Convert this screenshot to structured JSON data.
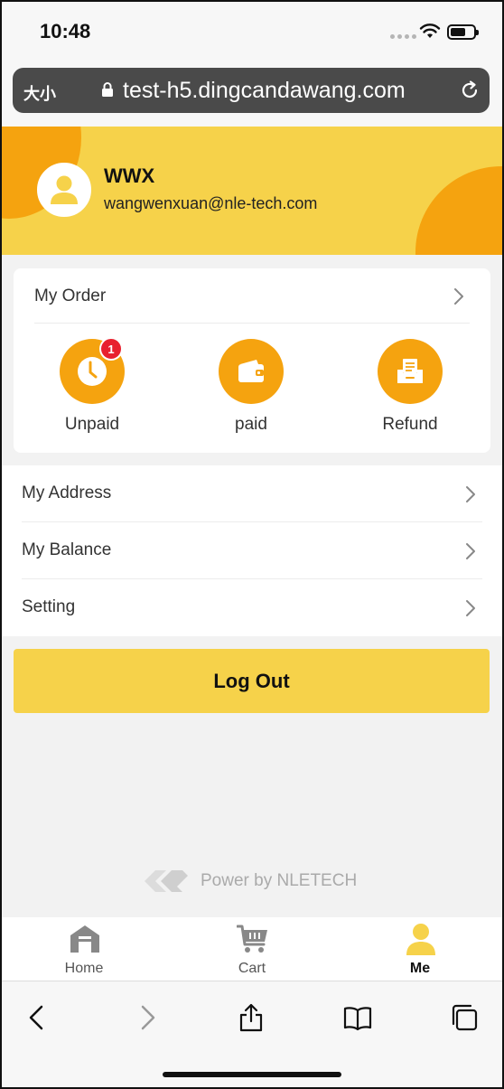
{
  "status_bar": {
    "time": "10:48"
  },
  "browser": {
    "text_size_label": "大小",
    "url": "test-h5.dingcandawang.com"
  },
  "profile": {
    "name": "WWX",
    "email": "wangwenxuan@nle-tech.com"
  },
  "order": {
    "title": "My Order",
    "items": [
      {
        "label": "Unpaid",
        "icon": "clock-icon",
        "badge": "1"
      },
      {
        "label": "paid",
        "icon": "wallet-icon"
      },
      {
        "label": "Refund",
        "icon": "refund-icon"
      }
    ]
  },
  "menu": {
    "items": [
      {
        "label": "My Address"
      },
      {
        "label": "My Balance"
      },
      {
        "label": "Setting"
      }
    ]
  },
  "logout_label": "Log Out",
  "footer": {
    "powered_text": "Power by NLETECH"
  },
  "tab_bar": {
    "items": [
      {
        "label": "Home",
        "icon": "home-icon",
        "active": false
      },
      {
        "label": "Cart",
        "icon": "cart-icon",
        "active": false
      },
      {
        "label": "Me",
        "icon": "person-icon",
        "active": true
      }
    ]
  },
  "colors": {
    "brand_yellow": "#f6d24a",
    "accent_orange": "#f5a30f",
    "badge_red": "#e8202e",
    "background": "#f2f2f2"
  }
}
